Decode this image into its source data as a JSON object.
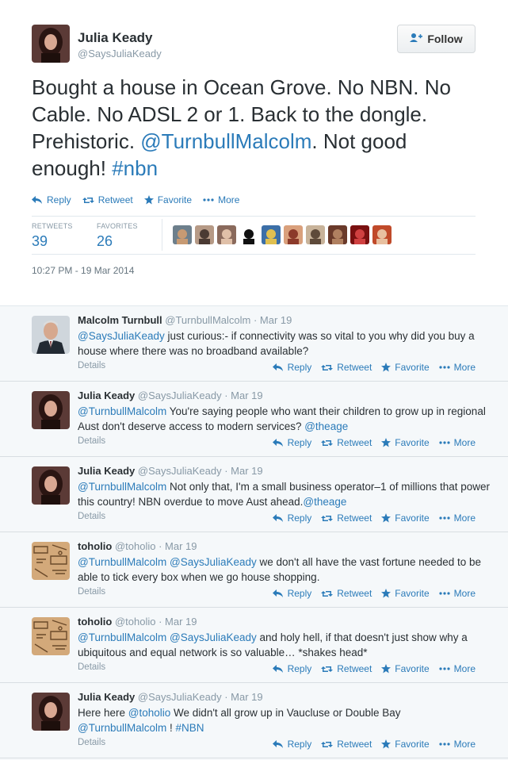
{
  "main": {
    "author_name": "Julia Keady",
    "author_handle": "@SaysJuliaKeady",
    "follow_label": "Follow",
    "text_parts": [
      {
        "text": "Bought a house in Ocean Grove. No NBN. No Cable. No ADSL 2 or 1. Back to the dongle. Prehistoric. ",
        "link": false
      },
      {
        "text": "@TurnbullMalcolm",
        "link": true
      },
      {
        "text": ". Not good enough! ",
        "link": false
      },
      {
        "text": "#nbn",
        "link": true
      }
    ],
    "actions": {
      "reply": "Reply",
      "retweet": "Retweet",
      "favorite": "Favorite",
      "more": "More"
    },
    "retweets_label": "RETWEETS",
    "retweets_count": "39",
    "favorites_label": "FAVORITES",
    "favorites_count": "26",
    "timestamp": "10:27 PM - 19 Mar 2014"
  },
  "favoriters_icons": [
    "avatar-1",
    "avatar-2",
    "avatar-3",
    "avatar-4",
    "avatar-5",
    "avatar-6",
    "avatar-7",
    "avatar-8",
    "avatar-9",
    "avatar-10"
  ],
  "replies": [
    {
      "name": "Malcolm Turnbull",
      "handle": "@TurnbullMalcolm",
      "date": "Mar 19",
      "avatar": "turnbull",
      "parts": [
        {
          "text": "@SaysJuliaKeady",
          "link": true
        },
        {
          "text": " just curious:- if connectivity was so vital to you why did you buy a house where there was no broadband available?",
          "link": false
        }
      ],
      "details": "Details"
    },
    {
      "name": "Julia Keady",
      "handle": "@SaysJuliaKeady",
      "date": "Mar 19",
      "avatar": "julia",
      "parts": [
        {
          "text": "@TurnbullMalcolm",
          "link": true
        },
        {
          "text": " You're saying people who want their children to grow up in regional Aust don't deserve access to modern services? ",
          "link": false
        },
        {
          "text": "@theage",
          "link": true
        }
      ],
      "details": "Details"
    },
    {
      "name": "Julia Keady",
      "handle": "@SaysJuliaKeady",
      "date": "Mar 19",
      "avatar": "julia",
      "parts": [
        {
          "text": "@TurnbullMalcolm",
          "link": true
        },
        {
          "text": " Not only that, I'm a small business operator–1 of millions that power this country! NBN overdue to move Aust ahead.",
          "link": false
        },
        {
          "text": "@theage",
          "link": true
        }
      ],
      "details": "Details"
    },
    {
      "name": "toholio",
      "handle": "@toholio",
      "date": "Mar 19",
      "avatar": "toholio",
      "parts": [
        {
          "text": "@TurnbullMalcolm",
          "link": true
        },
        {
          "text": " ",
          "link": false
        },
        {
          "text": "@SaysJuliaKeady",
          "link": true
        },
        {
          "text": " we don't all have the vast fortune needed to be able to tick every box when we go house shopping.",
          "link": false
        }
      ],
      "details": "Details"
    },
    {
      "name": "toholio",
      "handle": "@toholio",
      "date": "Mar 19",
      "avatar": "toholio",
      "parts": [
        {
          "text": "@TurnbullMalcolm",
          "link": true
        },
        {
          "text": " ",
          "link": false
        },
        {
          "text": "@SaysJuliaKeady",
          "link": true
        },
        {
          "text": " and holy hell, if that doesn't just show why a ubiquitous and equal network is so valuable… *shakes head*",
          "link": false
        }
      ],
      "details": "Details"
    },
    {
      "name": "Julia Keady",
      "handle": "@SaysJuliaKeady",
      "date": "Mar 19",
      "avatar": "julia",
      "parts": [
        {
          "text": "Here here ",
          "link": false
        },
        {
          "text": "@toholio",
          "link": true
        },
        {
          "text": " We didn't all grow up in Vaucluse or Double Bay ",
          "link": false
        },
        {
          "text": "@TurnbullMalcolm",
          "link": true
        },
        {
          "text": " ! ",
          "link": false
        },
        {
          "text": "#NBN",
          "link": true
        }
      ],
      "details": "Details"
    }
  ],
  "colors": {
    "link": "#2b7bb9",
    "muted": "#8899a6",
    "text": "#292f33",
    "reply_bg": "#f5f8fa"
  }
}
